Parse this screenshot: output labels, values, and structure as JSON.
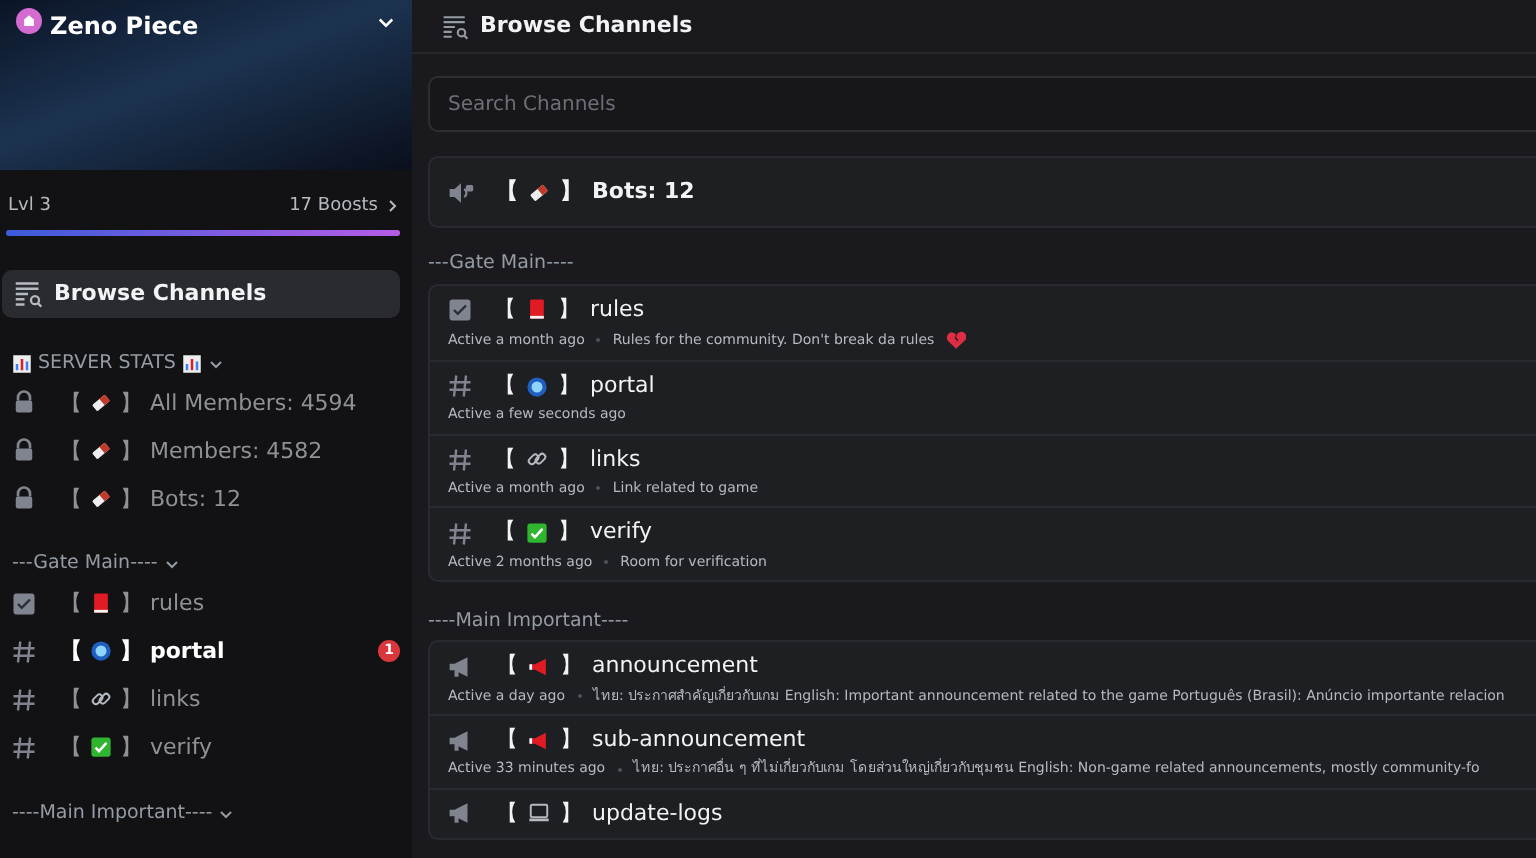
{
  "server": {
    "name": "Zeno Piece",
    "level": "Lvl 3",
    "boosts": "17 Boosts",
    "boost": {
      "level": 1.0
    }
  },
  "sidebar": {
    "browse": {
      "label": "Browse Channels",
      "selected": true
    },
    "categories": [
      {
        "name": "SERVER STATS",
        "icon_before": {
          "kind": "bar-chart"
        },
        "icon_after": {
          "kind": "bar-chart"
        },
        "expanded": true,
        "channels": [
          {
            "kind": "lock",
            "emoji": {
              "kind": "ticket"
            },
            "open": "【",
            "close": "】",
            "name": "All Members: 4594",
            "unread": false
          },
          {
            "kind": "lock",
            "emoji": {
              "kind": "ticket"
            },
            "open": "【",
            "close": "】",
            "name": "Members: 4582",
            "unread": false
          },
          {
            "kind": "lock",
            "emoji": {
              "kind": "ticket"
            },
            "open": "【",
            "close": "】",
            "name": "Bots: 12",
            "unread": false
          }
        ]
      },
      {
        "name": "---Gate Main----",
        "expanded": true,
        "channels": [
          {
            "kind": "rules",
            "emoji": {
              "kind": "book"
            },
            "open": "【",
            "close": "】",
            "name": "rules",
            "unread": false
          },
          {
            "kind": "text",
            "emoji": {
              "kind": "orb"
            },
            "open": "【",
            "close": "】",
            "name": "portal",
            "unread": true,
            "badge": "1"
          },
          {
            "kind": "text",
            "emoji": {
              "kind": "link"
            },
            "open": "【",
            "close": "】",
            "name": "links",
            "unread": false
          },
          {
            "kind": "text",
            "emoji": {
              "kind": "check"
            },
            "open": "【",
            "close": "】",
            "name": "verify",
            "unread": false
          }
        ]
      },
      {
        "name": "----Main Important----",
        "expanded": true
      }
    ]
  },
  "main": {
    "title": "Browse Channels",
    "search": {
      "placeholder": "Search Channels"
    },
    "loose": [
      {
        "kind": "voice",
        "emoji": {
          "kind": "ticket"
        },
        "open": "【",
        "close": "】",
        "name": "Bots: 12"
      }
    ],
    "groups": [
      {
        "name": "---Gate Main----",
        "channels": [
          {
            "kind": "rules",
            "emoji": {
              "kind": "book"
            },
            "open": "【",
            "close": "】",
            "name": "rules",
            "activity": "Active a month ago",
            "topic": "Rules for the community. Don't break da rules",
            "topic_emoji": {
              "kind": "broken-heart"
            }
          },
          {
            "kind": "text",
            "emoji": {
              "kind": "orb"
            },
            "open": "【",
            "close": "】",
            "name": "portal",
            "activity": "Active a few seconds ago"
          },
          {
            "kind": "text",
            "emoji": {
              "kind": "link"
            },
            "open": "【",
            "close": "】",
            "name": "links",
            "activity": "Active a month ago",
            "topic": "Link related to game"
          },
          {
            "kind": "text",
            "emoji": {
              "kind": "check"
            },
            "open": "【",
            "close": "】",
            "name": "verify",
            "activity": "Active 2 months ago",
            "topic": "Room for verification"
          }
        ]
      },
      {
        "name": "----Main Important----",
        "channels": [
          {
            "kind": "announce",
            "emoji": {
              "kind": "megaphone"
            },
            "open": "【",
            "close": "】",
            "name": "announcement",
            "activity": "Active a day ago",
            "topic": "ไทย: ประกาศสำคัญเกี่ยวกับเกม English: Important announcement related to the game Português (Brasil): Anúncio importante relacion"
          },
          {
            "kind": "announce",
            "emoji": {
              "kind": "megaphone"
            },
            "open": "【",
            "close": "】",
            "name": "sub-announcement",
            "activity": "Active 33 minutes ago",
            "topic": "ไทย: ประกาศอื่น ๆ ที่ไม่เกี่ยวกับเกม โดยส่วนใหญ่เกี่ยวกับชุมชน English: Non-game related announcements, mostly community-fo"
          },
          {
            "kind": "announce",
            "emoji": {
              "kind": "computer"
            },
            "open": "【",
            "close": "】",
            "name": "update-logs"
          }
        ]
      }
    ]
  }
}
